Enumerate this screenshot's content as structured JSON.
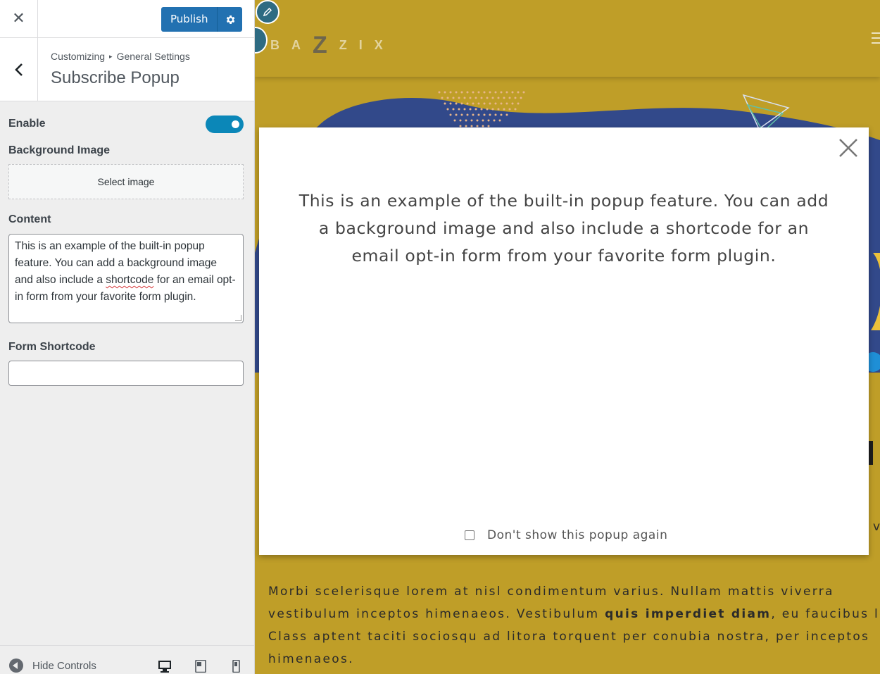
{
  "customizer": {
    "publish_label": "Publish",
    "breadcrumb": {
      "root": "Customizing",
      "parent": "General Settings"
    },
    "section_title": "Subscribe Popup",
    "controls": {
      "enable_label": "Enable",
      "enable_on": true,
      "background_image_label": "Background Image",
      "select_image_label": "Select image",
      "content_label": "Content",
      "content_value_before": "This is an example of the built-in popup feature. You can add a background image and also include a ",
      "content_value_spell": "shortcode",
      "content_value_after": " for an email opt-in form from your favorite form plugin.",
      "form_shortcode_label": "Form Shortcode",
      "form_shortcode_value": ""
    },
    "footer": {
      "hide_controls_label": "Hide Controls",
      "devices": [
        "desktop-icon",
        "tablet-icon",
        "mobile-icon"
      ]
    },
    "accent_color": "#2271b1"
  },
  "preview": {
    "logo_letters": [
      "B",
      "A",
      "Z",
      "Z",
      "I",
      "X"
    ],
    "body_text_part1": "Morbi scelerisque lorem at nisl condimentum varius. Nullam mattis viverra vestibulum inceptos himenaeos. Vestibulum ",
    "body_text_bold": "quis imperdiet diam",
    "body_text_part2": ", eu faucibus le Class aptent taciti sociosqu ad litora torquent per conubia nostra, per inceptos himenaeos.",
    "side_letter": "v",
    "background_color": "#bf9e28"
  },
  "popup": {
    "message": "This is an example of the built-in popup feature. You can add a background image and also include a shortcode for an email opt-in form from your favorite form plugin.",
    "dont_show_label": "Don't show this popup again"
  }
}
